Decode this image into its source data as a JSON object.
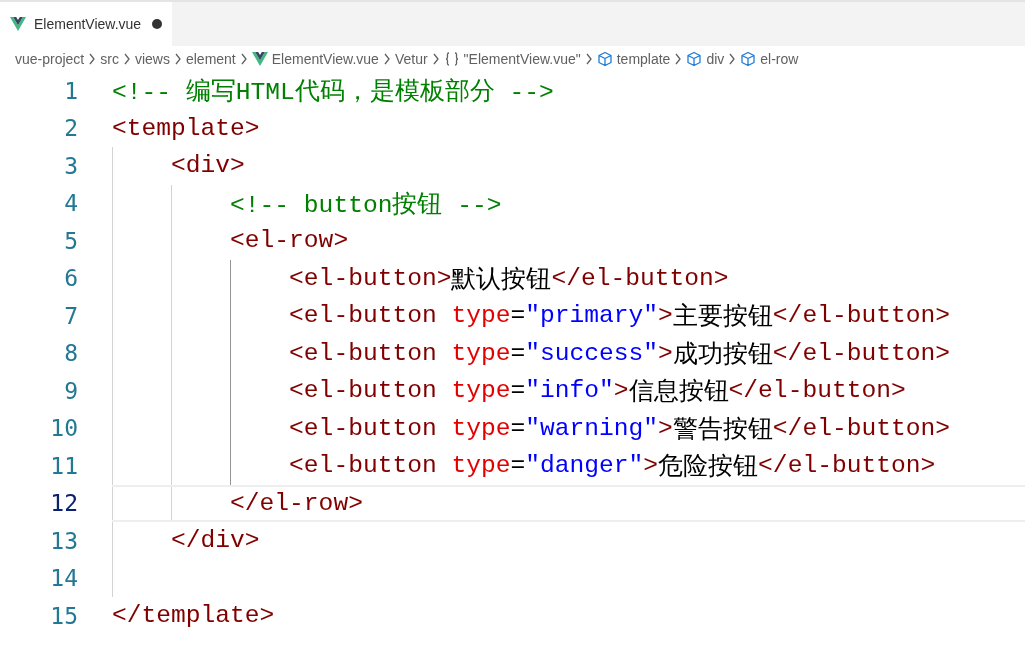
{
  "tab": {
    "label": "ElementView.vue",
    "selected": true,
    "modified": true
  },
  "breadcrumbs": [
    {
      "kind": "plain",
      "label": "vue-project"
    },
    {
      "kind": "plain",
      "label": "src"
    },
    {
      "kind": "plain",
      "label": "views"
    },
    {
      "kind": "plain",
      "label": "element"
    },
    {
      "kind": "vue-file",
      "label": "ElementView.vue"
    },
    {
      "kind": "plain",
      "label": "Vetur"
    },
    {
      "kind": "module",
      "label": "\"ElementView.vue\""
    },
    {
      "kind": "element",
      "label": "template"
    },
    {
      "kind": "element",
      "label": "div"
    },
    {
      "kind": "element",
      "label": "el-row"
    }
  ],
  "lines": [
    {
      "number": "1",
      "current": false,
      "tokens": [
        {
          "kind": "comment",
          "text": "<!-- 编写HTML代码，是模板部分 -->"
        }
      ]
    },
    {
      "number": "2",
      "current": false,
      "tokens": [
        {
          "kind": "tag",
          "text": "<template>"
        }
      ]
    },
    {
      "number": "3",
      "current": false,
      "tokens": [
        {
          "kind": "tag",
          "text": "    <div>"
        }
      ]
    },
    {
      "number": "4",
      "current": false,
      "tokens": [
        {
          "kind": "comment",
          "text": "        <!-- button按钮 -->"
        }
      ]
    },
    {
      "number": "5",
      "current": false,
      "tokens": [
        {
          "kind": "tag",
          "text": "        <el-row>"
        }
      ]
    },
    {
      "number": "6",
      "current": false,
      "tokens": [
        {
          "kind": "tag",
          "text": "            <el-button>"
        },
        {
          "kind": "text",
          "text": "默认按钮"
        },
        {
          "kind": "tag",
          "text": "</el-button>"
        }
      ]
    },
    {
      "number": "7",
      "current": false,
      "tokens": [
        {
          "kind": "tag",
          "text": "            <el-button "
        },
        {
          "kind": "attr",
          "text": "type"
        },
        {
          "kind": "punct",
          "text": "="
        },
        {
          "kind": "string",
          "text": "\"primary\""
        },
        {
          "kind": "tag",
          "text": ">"
        },
        {
          "kind": "text",
          "text": "主要按钮"
        },
        {
          "kind": "tag",
          "text": "</el-button>"
        }
      ]
    },
    {
      "number": "8",
      "current": false,
      "tokens": [
        {
          "kind": "tag",
          "text": "            <el-button "
        },
        {
          "kind": "attr",
          "text": "type"
        },
        {
          "kind": "punct",
          "text": "="
        },
        {
          "kind": "string",
          "text": "\"success\""
        },
        {
          "kind": "tag",
          "text": ">"
        },
        {
          "kind": "text",
          "text": "成功按钮"
        },
        {
          "kind": "tag",
          "text": "</el-button>"
        }
      ]
    },
    {
      "number": "9",
      "current": false,
      "tokens": [
        {
          "kind": "tag",
          "text": "            <el-button "
        },
        {
          "kind": "attr",
          "text": "type"
        },
        {
          "kind": "punct",
          "text": "="
        },
        {
          "kind": "string",
          "text": "\"info\""
        },
        {
          "kind": "tag",
          "text": ">"
        },
        {
          "kind": "text",
          "text": "信息按钮"
        },
        {
          "kind": "tag",
          "text": "</el-button>"
        }
      ]
    },
    {
      "number": "10",
      "current": false,
      "tokens": [
        {
          "kind": "tag",
          "text": "            <el-button "
        },
        {
          "kind": "attr",
          "text": "type"
        },
        {
          "kind": "punct",
          "text": "="
        },
        {
          "kind": "string",
          "text": "\"warning\""
        },
        {
          "kind": "tag",
          "text": ">"
        },
        {
          "kind": "text",
          "text": "警告按钮"
        },
        {
          "kind": "tag",
          "text": "</el-button>"
        }
      ]
    },
    {
      "number": "11",
      "current": false,
      "tokens": [
        {
          "kind": "tag",
          "text": "            <el-button "
        },
        {
          "kind": "attr",
          "text": "type"
        },
        {
          "kind": "punct",
          "text": "="
        },
        {
          "kind": "string",
          "text": "\"danger\""
        },
        {
          "kind": "tag",
          "text": ">"
        },
        {
          "kind": "text",
          "text": "危险按钮"
        },
        {
          "kind": "tag",
          "text": "</el-button>"
        }
      ]
    },
    {
      "number": "12",
      "current": true,
      "tokens": [
        {
          "kind": "tag",
          "text": "        </el-row>"
        }
      ]
    },
    {
      "number": "13",
      "current": false,
      "tokens": [
        {
          "kind": "tag",
          "text": "    </div>"
        }
      ]
    },
    {
      "number": "14",
      "current": false
    },
    {
      "number": "15",
      "current": false,
      "tokens": [
        {
          "kind": "tag",
          "text": "</template>"
        }
      ]
    }
  ]
}
